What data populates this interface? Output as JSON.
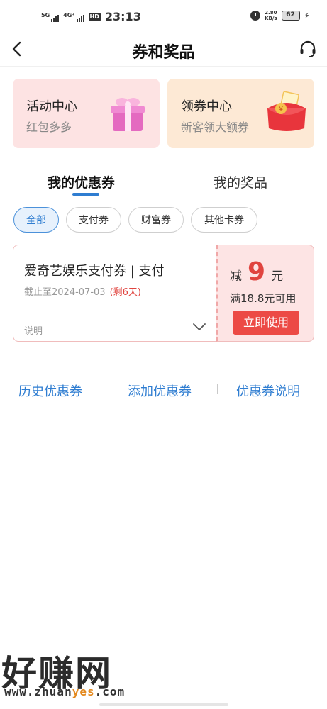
{
  "status_bar": {
    "net1": "5G",
    "net2": "4G⁺",
    "hd": "HD",
    "time": "23:13",
    "speed_value": "2.80",
    "speed_unit": "KB/s",
    "battery": "62"
  },
  "header": {
    "title": "券和奖品"
  },
  "promos": [
    {
      "title": "活动中心",
      "subtitle": "红包多多"
    },
    {
      "title": "领券中心",
      "subtitle": "新客领大额券"
    }
  ],
  "tabs": [
    {
      "label": "我的优惠券",
      "active": true
    },
    {
      "label": "我的奖品",
      "active": false
    }
  ],
  "filters": [
    {
      "label": "全部",
      "active": true
    },
    {
      "label": "支付券",
      "active": false
    },
    {
      "label": "财富券",
      "active": false
    },
    {
      "label": "其他卡券",
      "active": false
    }
  ],
  "coupon": {
    "name": "爱奇艺娱乐支付券 | 支付",
    "expire": "截止至2024-07-03",
    "remaining": "(剩6天)",
    "description_label": "说明",
    "amount_prefix": "减",
    "amount": "9",
    "amount_unit": "元",
    "condition": "满18.8元可用",
    "use_button": "立即使用"
  },
  "links": {
    "history": "历史优惠券",
    "add": "添加优惠券",
    "explain": "优惠券说明"
  },
  "watermark": {
    "main": "好赚网",
    "url_pre": "www.zhuan",
    "url_hl": "yes",
    "url_post": ".com"
  },
  "colors": {
    "accent_blue": "#2f7dd1",
    "accent_red": "#e0443f",
    "button_red": "#ec4a45"
  }
}
